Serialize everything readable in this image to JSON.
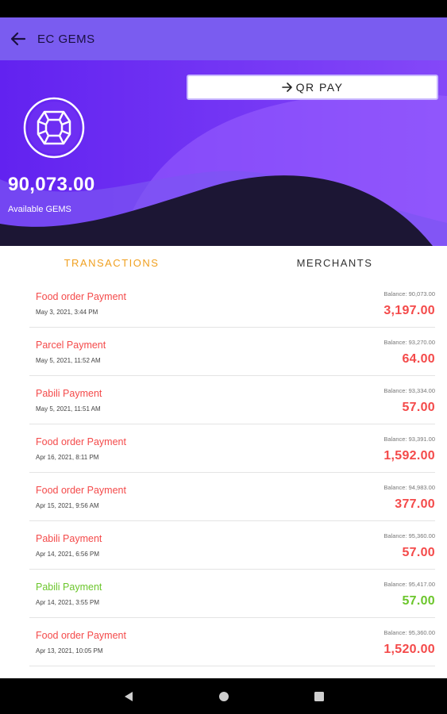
{
  "appbar": {
    "title": "EC GEMS"
  },
  "hero": {
    "qr_label": "QR PAY",
    "balance": "90,073.00",
    "balance_label": "Available GEMS"
  },
  "tabs": [
    {
      "label": "TRANSACTIONS",
      "active": true
    },
    {
      "label": "MERCHANTS",
      "active": false
    }
  ],
  "colors": {
    "accent": "#7a5cf0",
    "hero_dark": "#1c1634",
    "debit": "#f44a4a",
    "credit": "#6cc62c",
    "tab_active": "#f0a020"
  },
  "transactions": [
    {
      "title": "Food order Payment",
      "date": "May 3, 2021, 3:44 PM",
      "balance": "Balance: 90,073.00",
      "amount": "3,197.00",
      "type": "debit"
    },
    {
      "title": "Parcel Payment",
      "date": "May 5, 2021, 11:52 AM",
      "balance": "Balance: 93,270.00",
      "amount": "64.00",
      "type": "debit"
    },
    {
      "title": "Pabili Payment",
      "date": "May 5, 2021, 11:51 AM",
      "balance": "Balance: 93,334.00",
      "amount": "57.00",
      "type": "debit"
    },
    {
      "title": "Food order Payment",
      "date": "Apr 16, 2021, 8:11 PM",
      "balance": "Balance: 93,391.00",
      "amount": "1,592.00",
      "type": "debit"
    },
    {
      "title": "Food order Payment",
      "date": "Apr 15, 2021, 9:56 AM",
      "balance": "Balance: 94,983.00",
      "amount": "377.00",
      "type": "debit"
    },
    {
      "title": "Pabili Payment",
      "date": "Apr 14, 2021, 6:56 PM",
      "balance": "Balance: 95,360.00",
      "amount": "57.00",
      "type": "debit"
    },
    {
      "title": "Pabili Payment",
      "date": "Apr 14, 2021, 3:55 PM",
      "balance": "Balance: 95,417.00",
      "amount": "57.00",
      "type": "credit"
    },
    {
      "title": "Food order Payment",
      "date": "Apr 13, 2021, 10:05 PM",
      "balance": "Balance: 95,360.00",
      "amount": "1,520.00",
      "type": "debit"
    }
  ]
}
